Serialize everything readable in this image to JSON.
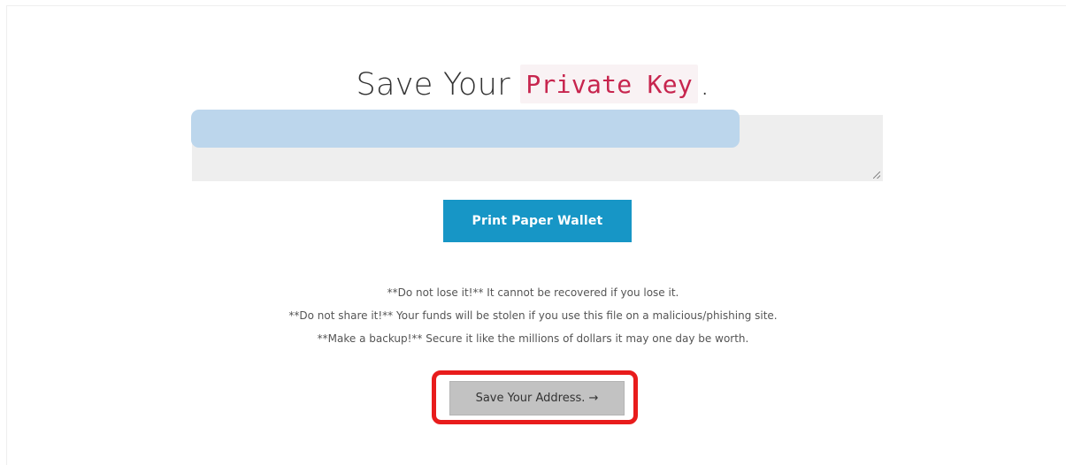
{
  "heading": {
    "prefix": "Save Your ",
    "code": "Private Key",
    "suffix": "."
  },
  "private_key_field": {
    "value": ""
  },
  "buttons": {
    "print_paper_wallet": "Print Paper Wallet",
    "save_your_address": "Save Your Address. →"
  },
  "warnings": [
    "**Do not lose it!** It cannot be recovered if you lose it.",
    "**Do not share it!** Your funds will be stolen if you use this file on a malicious/phishing site.",
    "**Make a backup!** Secure it like the millions of dollars it may one day be worth."
  ],
  "colors": {
    "primary_button": "#1796c6",
    "secondary_button": "#c2c2c2",
    "code_text": "#c7254e",
    "code_background": "#f9f2f4",
    "annotation_outline": "#e81c1c",
    "text_selection": "#bcd6ec"
  }
}
